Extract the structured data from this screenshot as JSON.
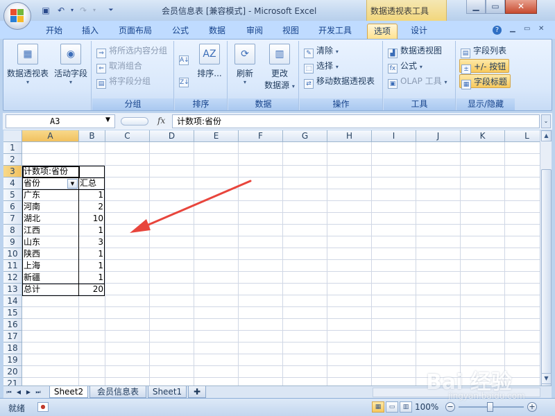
{
  "titlebar": {
    "title": "会员信息表  [兼容模式] - Microsoft Excel",
    "context_tool": "数据透视表工具"
  },
  "tabs": [
    "开始",
    "插入",
    "页面布局",
    "公式",
    "数据",
    "审阅",
    "视图",
    "开发工具",
    "选项",
    "设计"
  ],
  "active_tab": "选项",
  "ribbon": {
    "pivot_table_label": "数据透视表",
    "active_field_label": "活动字段",
    "group_selection": "将所选内容分组",
    "ungroup": "取消组合",
    "group_field": "将字段分组",
    "group_label_group": "分组",
    "sort_label": "排序...",
    "group_label_sort": "排序",
    "refresh": "刷新",
    "change_source_1": "更改",
    "change_source_2": "数据源",
    "group_label_data": "数据",
    "clear": "清除",
    "select": "选择",
    "move_pivot": "移动数据透视表",
    "group_label_actions": "操作",
    "pivot_chart": "数据透视图",
    "formulas": "公式",
    "olap_tools": "OLAP 工具",
    "group_label_tools": "工具",
    "field_list": "字段列表",
    "plus_minus": "+/- 按钮",
    "field_headers": "字段标题",
    "group_label_show_hide": "显示/隐藏"
  },
  "formula_bar": {
    "name_box": "A3",
    "fx": "fx",
    "formula": "计数项:省份"
  },
  "columns": [
    "A",
    "B",
    "C",
    "D",
    "E",
    "F",
    "G",
    "H",
    "I",
    "J",
    "K",
    "L"
  ],
  "rows": [
    "1",
    "2",
    "3",
    "4",
    "5",
    "6",
    "7",
    "8",
    "9",
    "10",
    "11",
    "12",
    "13",
    "14",
    "15",
    "16",
    "17",
    "18",
    "19",
    "20",
    "21"
  ],
  "pivot": {
    "header_a3": "计数项:省份",
    "col_a_header": "省份",
    "col_b_header": "汇总",
    "rows": [
      {
        "province": "广东",
        "count": "1"
      },
      {
        "province": "河南",
        "count": "2"
      },
      {
        "province": "湖北",
        "count": "10"
      },
      {
        "province": "江西",
        "count": "1"
      },
      {
        "province": "山东",
        "count": "3"
      },
      {
        "province": "陕西",
        "count": "1"
      },
      {
        "province": "上海",
        "count": "1"
      },
      {
        "province": "新疆",
        "count": "1"
      }
    ],
    "total_label": "总计",
    "total_value": "20"
  },
  "sheets": [
    "Sheet2",
    "会员信息表",
    "Sheet1"
  ],
  "active_sheet": "Sheet2",
  "status": {
    "ready": "就绪",
    "zoom": "100%"
  },
  "watermark": {
    "logo": "Bai 经验",
    "url": "jingyan.baidu.com"
  },
  "colors": {
    "arrow": "#e8453c",
    "ribbon_bg": "#dbe8fb",
    "tab_active": "#ffe28f"
  }
}
